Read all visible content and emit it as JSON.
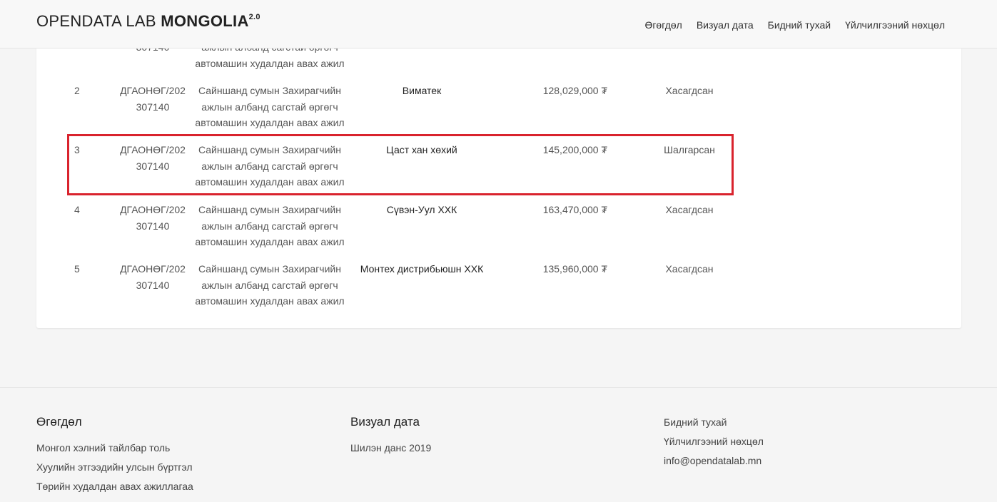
{
  "brand": {
    "light": "OPENDATA LAB ",
    "bold": "MONGOLIA",
    "version": "2.0"
  },
  "nav": [
    {
      "label": "Өгөгдөл"
    },
    {
      "label": "Визуал дата"
    },
    {
      "label": "Бидний тухай"
    },
    {
      "label": "Үйлчилгээний нөхцөл"
    }
  ],
  "table": {
    "partial_row": {
      "code_tail": "307140",
      "desc_tail_1": "ажлын албанд сагстай өргөгч",
      "desc_tail_2": "автомашин худалдан авах ажил"
    },
    "rows": [
      {
        "num": "2",
        "code_1": "ДГАОНӨГ/202",
        "code_2": "307140",
        "desc_1": "Сайншанд сумын Захирагчийн",
        "desc_2": "ажлын албанд сагстай өргөгч",
        "desc_3": "автомашин худалдан авах ажил",
        "supplier": "Виматек",
        "amount": "128,029,000 ₮",
        "status": "Хасагдсан"
      },
      {
        "num": "3",
        "code_1": "ДГАОНӨГ/202",
        "code_2": "307140",
        "desc_1": "Сайншанд сумын Захирагчийн",
        "desc_2": "ажлын албанд сагстай өргөгч",
        "desc_3": "автомашин худалдан авах ажил",
        "supplier": "Цаст хан хөхий",
        "amount": "145,200,000 ₮",
        "status": "Шалгарсан"
      },
      {
        "num": "4",
        "code_1": "ДГАОНӨГ/202",
        "code_2": "307140",
        "desc_1": "Сайншанд сумын Захирагчийн",
        "desc_2": "ажлын албанд сагстай өргөгч",
        "desc_3": "автомашин худалдан авах ажил",
        "supplier": "Сүвэн-Уул ХХК",
        "amount": "163,470,000 ₮",
        "status": "Хасагдсан"
      },
      {
        "num": "5",
        "code_1": "ДГАОНӨГ/202",
        "code_2": "307140",
        "desc_1": "Сайншанд сумын Захирагчийн",
        "desc_2": "ажлын албанд сагстай өргөгч",
        "desc_3": "автомашин худалдан авах ажил",
        "supplier": "Монтех дистрибьюшн ХХК",
        "amount": "135,960,000 ₮",
        "status": "Хасагдсан"
      }
    ]
  },
  "footer": {
    "col1": {
      "title": "Өгөгдөл",
      "links": [
        "Монгол хэлний тайлбар толь",
        "Хуулийн этгээдийн улсын бүртгэл",
        "Төрийн худалдан авах ажиллагаа"
      ]
    },
    "col2": {
      "title": "Визуал дата",
      "links": [
        "Шилэн данс 2019"
      ]
    },
    "col3": {
      "links": [
        "Бидний тухай",
        "Үйлчилгээний нөхцөл",
        "info@opendatalab.mn"
      ]
    }
  },
  "colors": {
    "highlight": "#d9232d"
  }
}
